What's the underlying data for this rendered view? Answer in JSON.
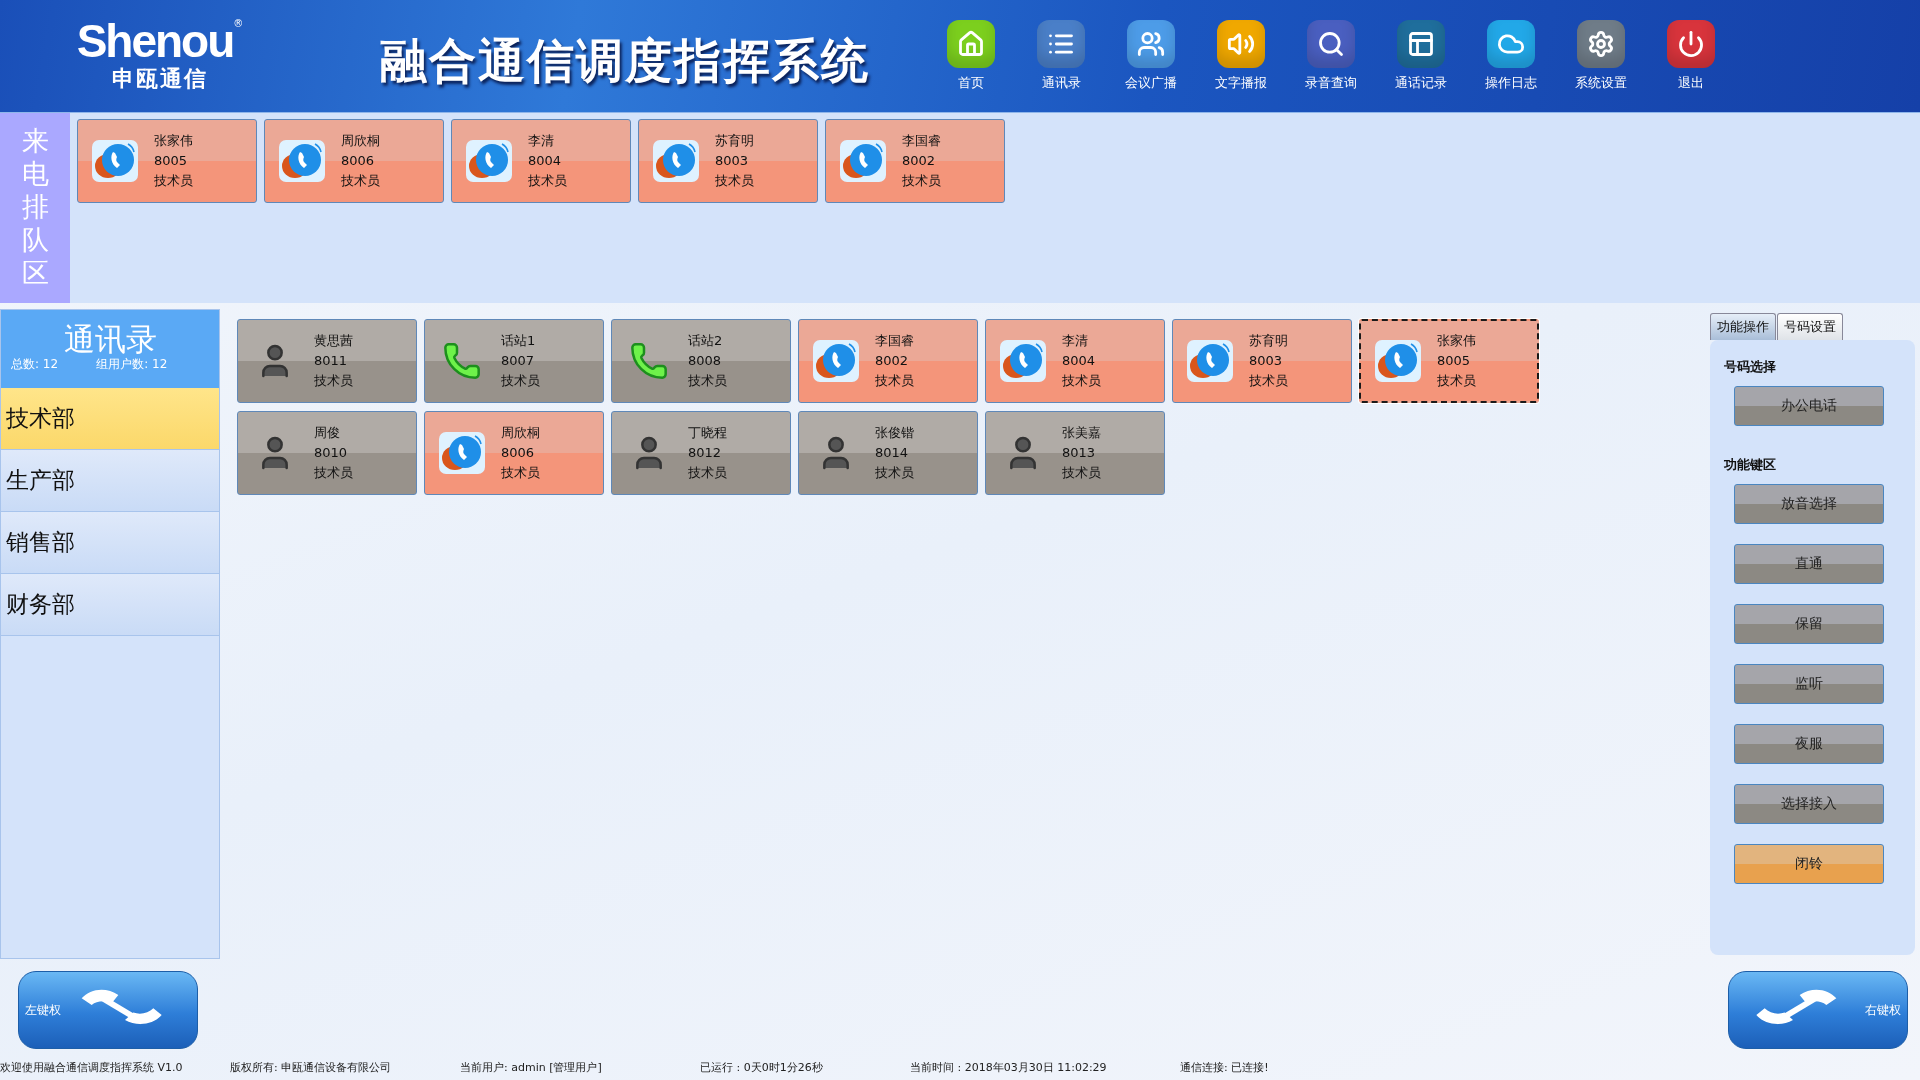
{
  "header": {
    "logo": {
      "brand": "Shenou",
      "mark": "®",
      "subtitle": "申瓯通信"
    },
    "title": "融合通信调度指挥系统",
    "nav": [
      {
        "label": "首页",
        "kind": "home",
        "color": "#7ccf1e"
      },
      {
        "label": "通讯录",
        "kind": "list",
        "color": "#4a7fc8"
      },
      {
        "label": "会议广播",
        "kind": "users",
        "color": "#4d9ce8"
      },
      {
        "label": "文字播报",
        "kind": "speaker",
        "color": "#f0a800"
      },
      {
        "label": "录音查询",
        "kind": "search",
        "color": "#4a5fc0"
      },
      {
        "label": "通话记录",
        "kind": "panels",
        "color": "#1f6e9c"
      },
      {
        "label": "操作日志",
        "kind": "cloud",
        "color": "#22a8e8"
      },
      {
        "label": "系统设置",
        "kind": "gear",
        "color": "#6f7c88"
      },
      {
        "label": "退出",
        "kind": "power",
        "color": "#d8343c"
      }
    ]
  },
  "queue": {
    "label": "来电排队区",
    "calls": [
      {
        "name": "张家伟",
        "number": "8005",
        "role": "技术员"
      },
      {
        "name": "周欣桐",
        "number": "8006",
        "role": "技术员"
      },
      {
        "name": "李清",
        "number": "8004",
        "role": "技术员"
      },
      {
        "name": "苏育明",
        "number": "8003",
        "role": "技术员"
      },
      {
        "name": "李国睿",
        "number": "8002",
        "role": "技术员"
      }
    ]
  },
  "directory": {
    "title": "通讯录",
    "total": "总数:  12",
    "group_users": "组用户数: 12",
    "departments": [
      {
        "label": "技术部",
        "selected": true
      },
      {
        "label": "生产部",
        "selected": false
      },
      {
        "label": "销售部",
        "selected": false
      },
      {
        "label": "财务部",
        "selected": false
      }
    ]
  },
  "users": [
    {
      "name": "黄思茜",
      "number": "8011",
      "role": "技术员",
      "kind": "idle",
      "selected": false
    },
    {
      "name": "话站1",
      "number": "8007",
      "role": "技术员",
      "kind": "phone",
      "selected": false
    },
    {
      "name": "话站2",
      "number": "8008",
      "role": "技术员",
      "kind": "phone",
      "selected": false
    },
    {
      "name": "李国睿",
      "number": "8002",
      "role": "技术员",
      "kind": "calling",
      "selected": false
    },
    {
      "name": "李清",
      "number": "8004",
      "role": "技术员",
      "kind": "calling",
      "selected": false
    },
    {
      "name": "苏育明",
      "number": "8003",
      "role": "技术员",
      "kind": "calling",
      "selected": false
    },
    {
      "name": "张家伟",
      "number": "8005",
      "role": "技术员",
      "kind": "calling",
      "selected": true
    },
    {
      "name": "周俊",
      "number": "8010",
      "role": "技术员",
      "kind": "idle",
      "selected": false
    },
    {
      "name": "周欣桐",
      "number": "8006",
      "role": "技术员",
      "kind": "calling",
      "selected": false
    },
    {
      "name": "丁晓程",
      "number": "8012",
      "role": "技术员",
      "kind": "idle",
      "selected": false
    },
    {
      "name": "张俊锴",
      "number": "8014",
      "role": "技术员",
      "kind": "idle",
      "selected": false
    },
    {
      "name": "张美嘉",
      "number": "8013",
      "role": "技术员",
      "kind": "idle",
      "selected": false
    }
  ],
  "side": {
    "tabs": [
      {
        "label": "功能操作",
        "selected": true
      },
      {
        "label": "号码设置",
        "selected": false
      }
    ],
    "sections": [
      {
        "title": "号码选择",
        "buttons": [
          {
            "label": "办公电话",
            "highlighted": false
          }
        ]
      },
      {
        "title": "功能键区",
        "buttons": [
          {
            "label": "放音选择",
            "highlighted": false
          },
          {
            "label": "直通",
            "highlighted": false
          },
          {
            "label": "保留",
            "highlighted": false
          },
          {
            "label": "监听",
            "highlighted": false
          },
          {
            "label": "夜服",
            "highlighted": false
          },
          {
            "label": "选择接入",
            "highlighted": false
          },
          {
            "label": "闭铃",
            "highlighted": true
          }
        ]
      }
    ]
  },
  "handsets": {
    "left": "左键权",
    "right": "右键权"
  },
  "status_bar": [
    "欢迎使用融合通信调度指挥系统 V1.0",
    "版权所有: 申瓯通信设备有限公司",
    "当前用户: admin [管理用户]",
    "已运行 : 0天0时1分26秒",
    "当前时间 : 2018年03月30日 11:02:29",
    "通信连接: 已连接!"
  ]
}
